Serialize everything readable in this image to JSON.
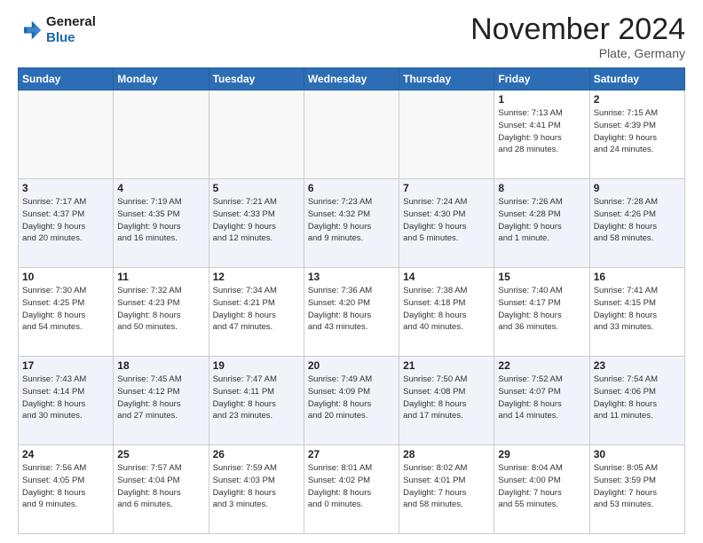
{
  "logo": {
    "line1": "General",
    "line2": "Blue"
  },
  "header": {
    "title": "November 2024",
    "subtitle": "Plate, Germany"
  },
  "days_of_week": [
    "Sunday",
    "Monday",
    "Tuesday",
    "Wednesday",
    "Thursday",
    "Friday",
    "Saturday"
  ],
  "weeks": [
    [
      {
        "day": "",
        "info": ""
      },
      {
        "day": "",
        "info": ""
      },
      {
        "day": "",
        "info": ""
      },
      {
        "day": "",
        "info": ""
      },
      {
        "day": "",
        "info": ""
      },
      {
        "day": "1",
        "info": "Sunrise: 7:13 AM\nSunset: 4:41 PM\nDaylight: 9 hours\nand 28 minutes."
      },
      {
        "day": "2",
        "info": "Sunrise: 7:15 AM\nSunset: 4:39 PM\nDaylight: 9 hours\nand 24 minutes."
      }
    ],
    [
      {
        "day": "3",
        "info": "Sunrise: 7:17 AM\nSunset: 4:37 PM\nDaylight: 9 hours\nand 20 minutes."
      },
      {
        "day": "4",
        "info": "Sunrise: 7:19 AM\nSunset: 4:35 PM\nDaylight: 9 hours\nand 16 minutes."
      },
      {
        "day": "5",
        "info": "Sunrise: 7:21 AM\nSunset: 4:33 PM\nDaylight: 9 hours\nand 12 minutes."
      },
      {
        "day": "6",
        "info": "Sunrise: 7:23 AM\nSunset: 4:32 PM\nDaylight: 9 hours\nand 9 minutes."
      },
      {
        "day": "7",
        "info": "Sunrise: 7:24 AM\nSunset: 4:30 PM\nDaylight: 9 hours\nand 5 minutes."
      },
      {
        "day": "8",
        "info": "Sunrise: 7:26 AM\nSunset: 4:28 PM\nDaylight: 9 hours\nand 1 minute."
      },
      {
        "day": "9",
        "info": "Sunrise: 7:28 AM\nSunset: 4:26 PM\nDaylight: 8 hours\nand 58 minutes."
      }
    ],
    [
      {
        "day": "10",
        "info": "Sunrise: 7:30 AM\nSunset: 4:25 PM\nDaylight: 8 hours\nand 54 minutes."
      },
      {
        "day": "11",
        "info": "Sunrise: 7:32 AM\nSunset: 4:23 PM\nDaylight: 8 hours\nand 50 minutes."
      },
      {
        "day": "12",
        "info": "Sunrise: 7:34 AM\nSunset: 4:21 PM\nDaylight: 8 hours\nand 47 minutes."
      },
      {
        "day": "13",
        "info": "Sunrise: 7:36 AM\nSunset: 4:20 PM\nDaylight: 8 hours\nand 43 minutes."
      },
      {
        "day": "14",
        "info": "Sunrise: 7:38 AM\nSunset: 4:18 PM\nDaylight: 8 hours\nand 40 minutes."
      },
      {
        "day": "15",
        "info": "Sunrise: 7:40 AM\nSunset: 4:17 PM\nDaylight: 8 hours\nand 36 minutes."
      },
      {
        "day": "16",
        "info": "Sunrise: 7:41 AM\nSunset: 4:15 PM\nDaylight: 8 hours\nand 33 minutes."
      }
    ],
    [
      {
        "day": "17",
        "info": "Sunrise: 7:43 AM\nSunset: 4:14 PM\nDaylight: 8 hours\nand 30 minutes."
      },
      {
        "day": "18",
        "info": "Sunrise: 7:45 AM\nSunset: 4:12 PM\nDaylight: 8 hours\nand 27 minutes."
      },
      {
        "day": "19",
        "info": "Sunrise: 7:47 AM\nSunset: 4:11 PM\nDaylight: 8 hours\nand 23 minutes."
      },
      {
        "day": "20",
        "info": "Sunrise: 7:49 AM\nSunset: 4:09 PM\nDaylight: 8 hours\nand 20 minutes."
      },
      {
        "day": "21",
        "info": "Sunrise: 7:50 AM\nSunset: 4:08 PM\nDaylight: 8 hours\nand 17 minutes."
      },
      {
        "day": "22",
        "info": "Sunrise: 7:52 AM\nSunset: 4:07 PM\nDaylight: 8 hours\nand 14 minutes."
      },
      {
        "day": "23",
        "info": "Sunrise: 7:54 AM\nSunset: 4:06 PM\nDaylight: 8 hours\nand 11 minutes."
      }
    ],
    [
      {
        "day": "24",
        "info": "Sunrise: 7:56 AM\nSunset: 4:05 PM\nDaylight: 8 hours\nand 9 minutes."
      },
      {
        "day": "25",
        "info": "Sunrise: 7:57 AM\nSunset: 4:04 PM\nDaylight: 8 hours\nand 6 minutes."
      },
      {
        "day": "26",
        "info": "Sunrise: 7:59 AM\nSunset: 4:03 PM\nDaylight: 8 hours\nand 3 minutes."
      },
      {
        "day": "27",
        "info": "Sunrise: 8:01 AM\nSunset: 4:02 PM\nDaylight: 8 hours\nand 0 minutes."
      },
      {
        "day": "28",
        "info": "Sunrise: 8:02 AM\nSunset: 4:01 PM\nDaylight: 7 hours\nand 58 minutes."
      },
      {
        "day": "29",
        "info": "Sunrise: 8:04 AM\nSunset: 4:00 PM\nDaylight: 7 hours\nand 55 minutes."
      },
      {
        "day": "30",
        "info": "Sunrise: 8:05 AM\nSunset: 3:59 PM\nDaylight: 7 hours\nand 53 minutes."
      }
    ]
  ]
}
